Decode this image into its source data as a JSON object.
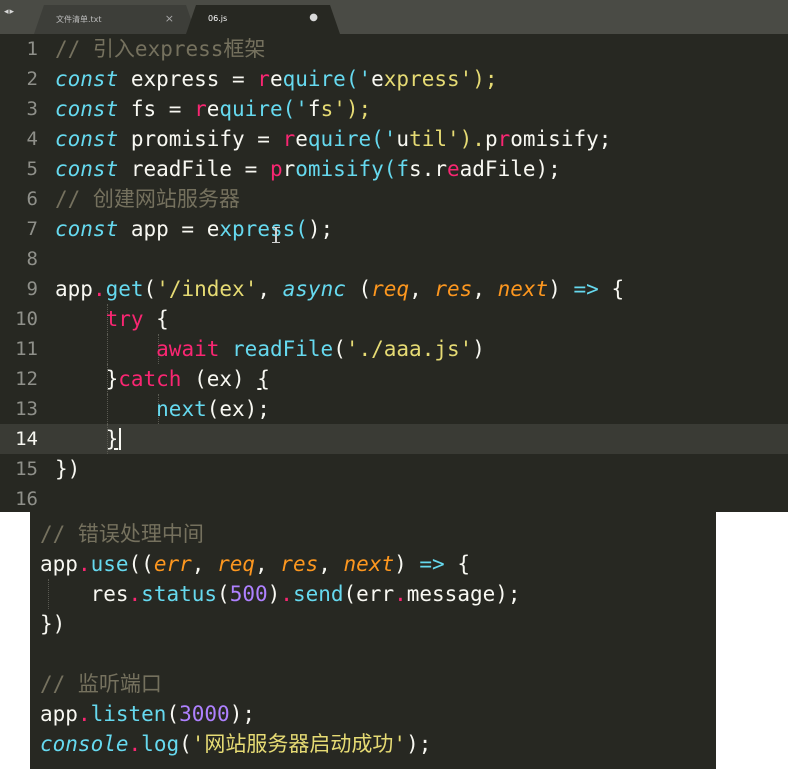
{
  "tabs": [
    {
      "label": "文件清单.txt",
      "close_glyph": "×",
      "active": false
    },
    {
      "label": "06.js",
      "dirty_glyph": "●",
      "active": true
    }
  ],
  "nav_glyph": "◂▸",
  "editor": {
    "line_numbers": [
      "1",
      "2",
      "3",
      "4",
      "5",
      "6",
      "7",
      "8",
      "9",
      "10",
      "11",
      "12",
      "13",
      "14",
      "15",
      "16"
    ],
    "current_line": 14,
    "lines": [
      "// 引入express框架",
      "const express = require('express');",
      "const fs = require('fs');",
      "const promisify = require('util').promisify;",
      "const readFile = promisify(fs.readFile);",
      "// 创建网站服务器",
      "const app = express();",
      "",
      "app.get('/index', async (req, res, next) => {",
      "    try {",
      "        await readFile('./aaa.js')",
      "    }catch (ex) {",
      "        next(ex);",
      "    }",
      "})",
      ""
    ]
  },
  "overlay": {
    "lines": [
      "// 错误处理中间",
      "app.use((err, req, res, next) => {",
      "    res.status(500).send(err.message);",
      "})",
      "",
      "// 监听端口",
      "app.listen(3000);",
      "console.log('网站服务器启动成功');"
    ]
  },
  "colors": {
    "background": "#272822",
    "tabbar": "#4a4b45",
    "comment": "#75715e",
    "storage": "#66d9ef",
    "keyword": "#f92672",
    "string": "#e6db74",
    "parameter": "#fd971f",
    "number": "#ae81ff",
    "foreground": "#f8f8f2"
  }
}
